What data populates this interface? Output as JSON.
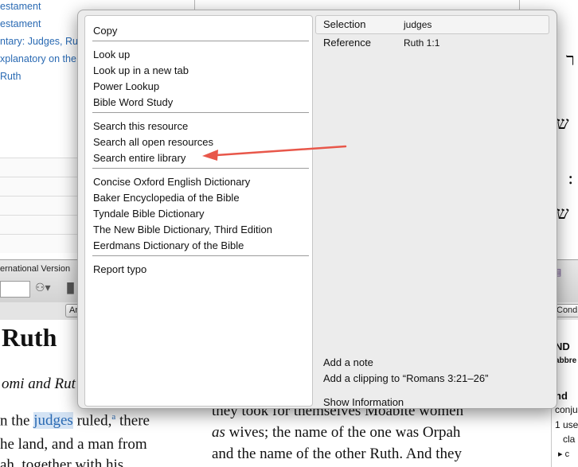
{
  "library": {
    "links": [
      "estament",
      "estament",
      "ntary: Judges, Rut",
      "xplanatory on the",
      "Ruth"
    ]
  },
  "hebrew": {
    "lines": [
      "ר",
      "ש",
      ":",
      "ש"
    ]
  },
  "toolbar": {
    "resource_title": "ernational Version",
    "subbar_button_left": "Ar",
    "subbar_button_right": "Cond"
  },
  "reader_left": {
    "heading": "Ruth",
    "subheading": "omi and Rut",
    "line1_pre": "n the ",
    "line1_highlight": "judges",
    "line1_post": " ruled,",
    "line1_sup": "a",
    "line1_tail": " there",
    "line2": "he land, and a man from",
    "line3": "ah, together with his"
  },
  "reader_mid": {
    "line1": "they took for themselves Moabite women",
    "line2_italic": "as",
    "line2_rest": " wives; the name of the one was Orpah",
    "line3": "and the name of the other Ruth. And they"
  },
  "reader_right": {
    "lines": [
      "ND",
      "abbre",
      "nd",
      "conju",
      "1 use",
      "cla",
      "▸ c"
    ]
  },
  "menu": {
    "copy": "Copy",
    "group_lookup": [
      "Look up",
      "Look up in a new tab",
      "Power Lookup",
      "Bible Word Study"
    ],
    "group_search": [
      "Search this resource",
      "Search all open resources",
      "Search entire library"
    ],
    "group_dictionaries": [
      "Concise Oxford English Dictionary",
      "Baker Encyclopedia of the Bible",
      "Tyndale Bible Dictionary",
      "The New Bible Dictionary, Third Edition",
      "Eerdmans Dictionary of the Bible"
    ],
    "report_typo": "Report typo",
    "selection_label": "Selection",
    "selection_value": "judges",
    "reference_label": "Reference",
    "reference_value": "Ruth 1:1",
    "add_note": "Add a note",
    "add_clipping": "Add a clipping to “Romans 3:21–26”",
    "show_information": "Show Information"
  },
  "colors": {
    "link": "#2a6ab3",
    "arrow": "#e8574a",
    "menu_bg": "#ececec"
  }
}
